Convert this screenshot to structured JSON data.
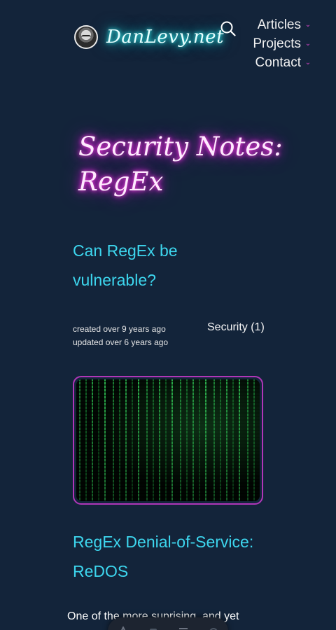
{
  "header": {
    "site_name": "DanLevy.net",
    "icons": {
      "search": "search-icon",
      "avatar": "avatar"
    },
    "nav": [
      {
        "label": "Articles"
      },
      {
        "label": "Projects"
      },
      {
        "label": "Contact"
      }
    ]
  },
  "page": {
    "title": "Security Notes: RegEx"
  },
  "articles": [
    {
      "title": "Can RegEx be vulnerable?",
      "created": "created over 9 years ago",
      "updated": "updated over 6 years ago",
      "tag": "Security (1)"
    },
    {
      "title": "RegEx Denial-of-Service: ReDOS",
      "excerpt": "One of the more suprising, and yet"
    }
  ],
  "colors": {
    "background": "#13243a",
    "link": "#3dd6ee",
    "accent": "#d946c9",
    "title_glow": "#ff4de3",
    "brand_glow": "#33ffff"
  }
}
